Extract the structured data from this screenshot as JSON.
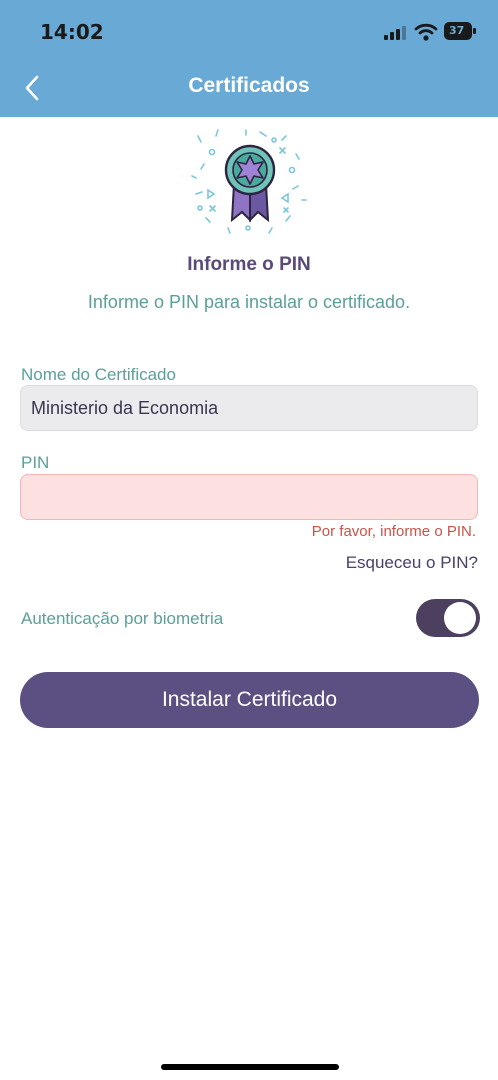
{
  "status": {
    "time": "14:02",
    "battery": "37"
  },
  "header": {
    "title": "Certificados"
  },
  "content": {
    "heading": "Informe o PIN",
    "subtitle": "Informe o PIN para instalar o certificado."
  },
  "form": {
    "name_label": "Nome do Certificado",
    "name_value": "Ministerio da Economia",
    "pin_label": "PIN",
    "pin_value": "",
    "pin_error": "Por favor, informe o PIN.",
    "forgot_link": "Esqueceu o PIN?",
    "biometric_label": "Autenticação por biometria",
    "biometric_enabled": true,
    "install_button": "Instalar Certificado"
  },
  "icons": {
    "back": "chevron-left-icon",
    "badge": "award-ribbon-icon",
    "signal": "cellular-signal-icon",
    "wifi": "wifi-icon",
    "battery": "battery-icon"
  },
  "colors": {
    "header_bg": "#68a9d6",
    "primary": "#5c4f82",
    "accent_teal": "#5a9f9a",
    "error": "#c9534a"
  }
}
